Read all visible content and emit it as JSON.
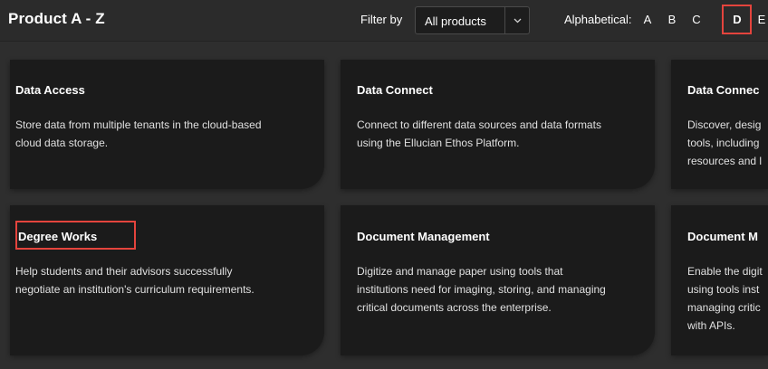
{
  "header": {
    "title": "Product A - Z",
    "filter_label": "Filter by",
    "filter_select": {
      "value": "All products"
    },
    "alphabetical_label": "Alphabetical:",
    "letters": [
      "A",
      "B",
      "C",
      "D",
      "E"
    ],
    "active_letter": "D",
    "highlight_color": "#e4443d"
  },
  "cards": [
    {
      "title": "Data Access",
      "description": [
        "Store data from multiple tenants in the cloud-based",
        "cloud data storage."
      ]
    },
    {
      "title": "Data Connect",
      "description": [
        "Connect to different data sources and data formats",
        "using the Ellucian Ethos Platform."
      ]
    },
    {
      "title": "Data Connec",
      "description": [
        "Discover, desig",
        "tools, including",
        "resources and l"
      ]
    },
    {
      "title": "Degree Works",
      "description": [
        "Help students and their advisors successfully",
        "negotiate an institution's curriculum requirements."
      ]
    },
    {
      "title": "Document Management",
      "description": [
        "Digitize and manage paper using tools that",
        "institutions need for imaging, storing, and managing",
        "critical documents across the enterprise."
      ]
    },
    {
      "title": "Document M",
      "description": [
        "Enable the digit",
        "using tools inst",
        "managing critic",
        "with APIs."
      ]
    }
  ]
}
